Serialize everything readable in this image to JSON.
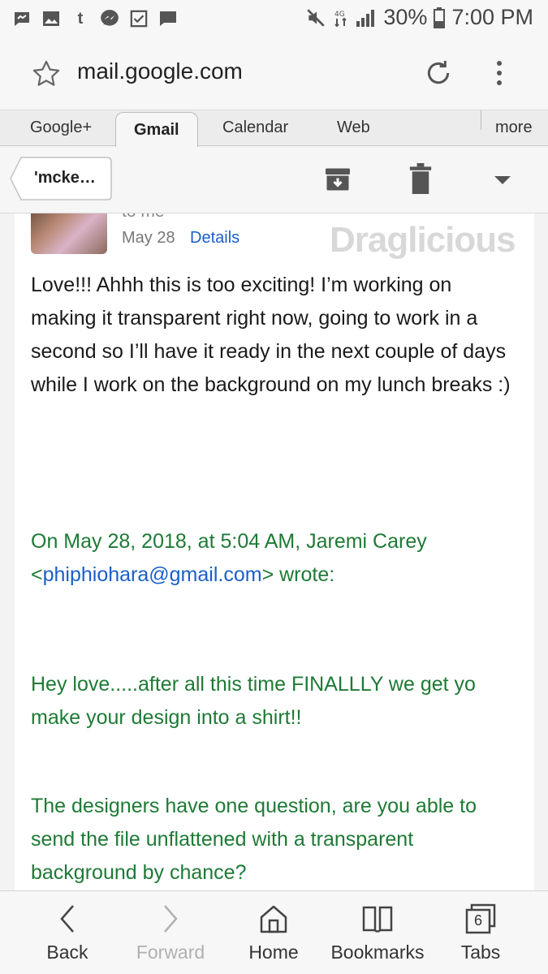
{
  "status_bar": {
    "battery": "30%",
    "time": "7:00 PM",
    "tumblr_glyph": "t",
    "icons": [
      "messenger-icon",
      "gallery-icon",
      "tumblr-icon",
      "messenger-bubble-icon",
      "checkbox-icon",
      "chat-icon",
      "mute-icon",
      "data-icon",
      "signal-icon",
      "battery-icon"
    ]
  },
  "browser": {
    "url": "mail.google.com"
  },
  "tabs": {
    "items": [
      "Google+",
      "Gmail",
      "Calendar",
      "Web"
    ],
    "active": "Gmail",
    "more": "more"
  },
  "action_bar": {
    "back_label": "'mcke…"
  },
  "email": {
    "to": "to me",
    "date": "May 28",
    "details_link": "Details",
    "watermark": "Draglicious",
    "body": "Love!!! Ahhh this is too exciting! I’m working on making it transparent right now, going to work in a second so I’ll have it ready in the next couple of days while I work on the background on my lunch breaks :)",
    "quote_header_1": "On May 28, 2018, at 5:04 AM, Jaremi Carey",
    "quote_email": "phiphiohara@gmail.com",
    "quote_open": "<",
    "quote_close": "> wrote:",
    "quote_p1_l1": "Hey love.....after all this time FINALLLY we get yo",
    "quote_p1_l2": "make your design into a shirt!!",
    "quote_p2_l1": "The designers have one question, are you able to",
    "quote_p2_l2": "send the file unflattened with a transparent",
    "quote_p2_l3": "background by chance?"
  },
  "bottom_nav": {
    "back": "Back",
    "forward": "Forward",
    "home": "Home",
    "bookmarks": "Bookmarks",
    "tabs": "Tabs",
    "tabs_count": "6"
  },
  "colors": {
    "link": "#1a5fc8",
    "quote": "#1e7a35"
  }
}
